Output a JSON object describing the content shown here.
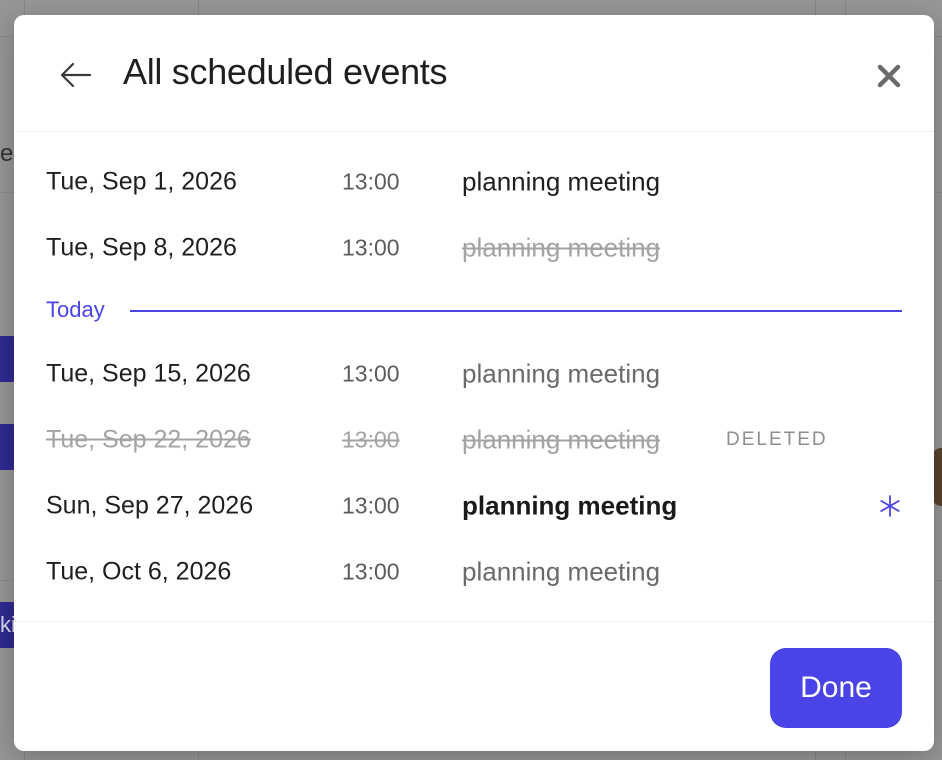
{
  "modal": {
    "title": "All scheduled events",
    "back_icon": "arrow-left-icon",
    "close_icon": "close-icon"
  },
  "events_before": [
    {
      "date": "Tue, Sep 1, 2026",
      "time": "13:00",
      "name": "planning meeting"
    },
    {
      "date": "Tue, Sep 8, 2026",
      "time": "13:00",
      "name": "planning meeting"
    }
  ],
  "today_label": "Today",
  "events_after": [
    {
      "date": "Tue, Sep 15, 2026",
      "time": "13:00",
      "name": "planning meeting"
    },
    {
      "date": "Tue, Sep 22, 2026",
      "time": "13:00",
      "name": "planning meeting",
      "tag": "DELETED"
    },
    {
      "date": "Sun, Sep 27, 2026",
      "time": "13:00",
      "name": "planning meeting",
      "icon": "asterisk-icon"
    },
    {
      "date": "Tue, Oct 6, 2026",
      "time": "13:00",
      "name": "planning meeting"
    }
  ],
  "footer": {
    "done_label": "Done"
  },
  "colors": {
    "accent": "#4a43e8",
    "text_primary": "#1f1f1f",
    "text_muted": "#6a6a6a",
    "text_struck": "#a3a3a3"
  }
}
